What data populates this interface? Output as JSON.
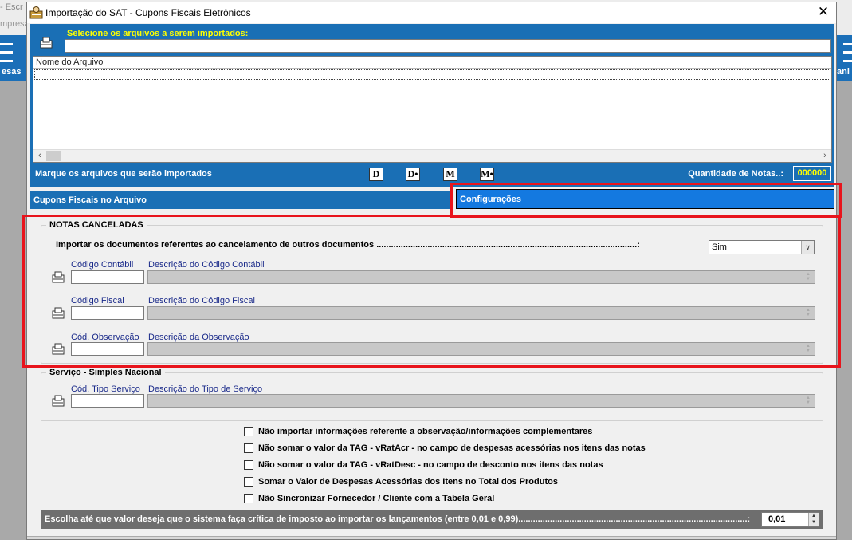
{
  "background_app": {
    "title_fragment": "- Escr",
    "subtitle_fragment": "mpresa",
    "left_tool_label": "esas",
    "right_tool_label": "ani"
  },
  "dialog": {
    "title": "Importação do SAT - Cupons Fiscais Eletrônicos",
    "close_glyph": "✕"
  },
  "files": {
    "select_label": "Selecione os arquivos a serem importados:",
    "select_value": "",
    "column_header": "Nome do Arquivo",
    "mark_label": "Marque os arquivos que serão importados",
    "mark_buttons": [
      "D",
      "D•",
      "M",
      "M•"
    ],
    "qty_label": "Quantidade de Notas..:",
    "qty_value": "000000"
  },
  "tabs": {
    "tab1": "Cupons Fiscais no Arquivo",
    "tab2": "Configurações"
  },
  "notas_canceladas": {
    "legend": "NOTAS CANCELADAS",
    "import_label": "Importar os documentos referentes ao cancelamento de outros documentos ...........................................................................................................:",
    "import_value": "Sim",
    "codigo_contabil_label": "Código Contábil",
    "desc_contabil_label": "Descrição do Código Contábil",
    "codigo_fiscal_label": "Código Fiscal",
    "desc_fiscal_label": "Descrição do Código Fiscal",
    "cod_obs_label": "Cód. Observação",
    "desc_obs_label": "Descrição da Observação"
  },
  "servico": {
    "legend": "Serviço - Simples Nacional",
    "cod_tipo_label": "Cód. Tipo Serviço",
    "desc_tipo_label": "Descrição do Tipo de Serviço"
  },
  "options": [
    "Não importar informações referente a observação/informações complementares",
    "Não somar o valor da TAG - vRatAcr - no campo de despesas acessórias nos itens das notas",
    "Não somar o valor da TAG - vRatDesc - no campo de desconto nos itens das notas",
    "Somar o Valor de Despesas Acessórias dos Itens no Total dos Produtos",
    "Não Sincronizar Fornecedor / Cliente com a Tabela Geral"
  ],
  "critica": {
    "label": "Escolha até que valor deseja que o sistema faça crítica de imposto ao importar os lançamentos (entre 0,01 e 0,99)..............................................................................................:",
    "value": "0,01"
  }
}
